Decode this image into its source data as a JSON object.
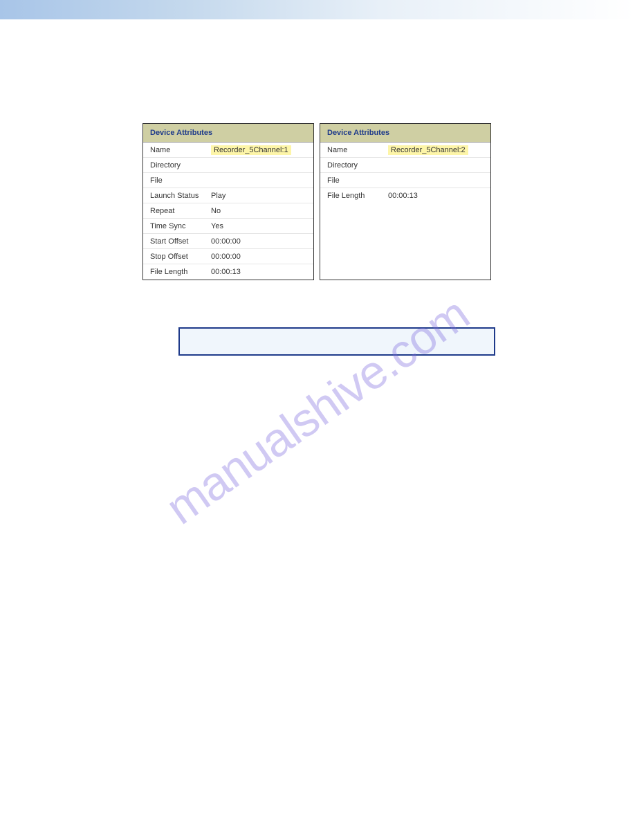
{
  "watermark": "manualshive.com",
  "panel1": {
    "header": "Device Attributes",
    "rows": [
      {
        "label": "Name",
        "value": "Recorder_5Channel:1",
        "highlight": true
      },
      {
        "label": "Directory",
        "value": ""
      },
      {
        "label": "File",
        "value": ""
      },
      {
        "label": "Launch Status",
        "value": "Play"
      },
      {
        "label": "Repeat",
        "value": "No"
      },
      {
        "label": "Time Sync",
        "value": "Yes"
      },
      {
        "label": "Start Offset",
        "value": "00:00:00"
      },
      {
        "label": "Stop Offset",
        "value": "00:00:00"
      },
      {
        "label": "File Length",
        "value": "00:00:13"
      }
    ]
  },
  "panel2": {
    "header": "Device Attributes",
    "rows": [
      {
        "label": "Name",
        "value": "Recorder_5Channel:2",
        "highlight": true
      },
      {
        "label": "Directory",
        "value": ""
      },
      {
        "label": "File",
        "value": ""
      },
      {
        "label": "File Length",
        "value": "00:00:13"
      }
    ]
  }
}
